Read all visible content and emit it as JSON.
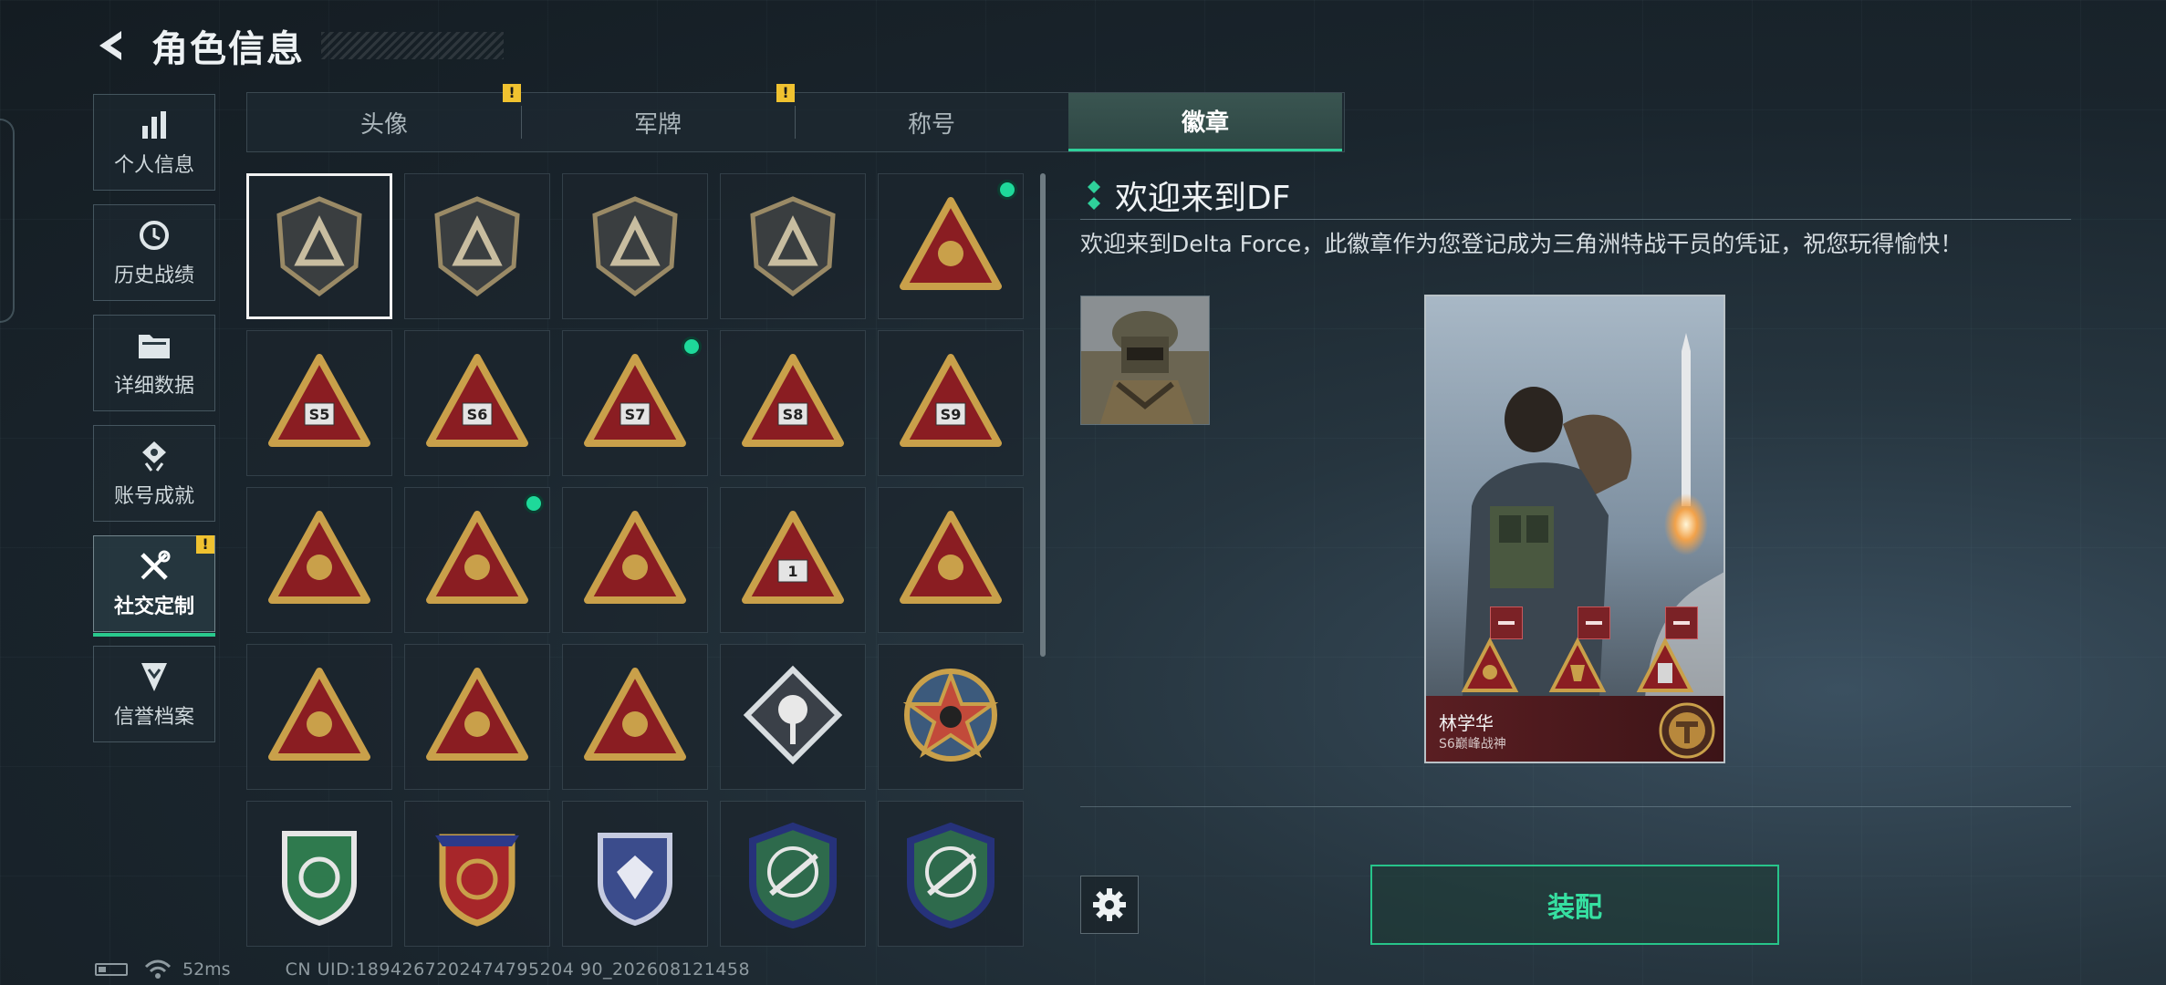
{
  "header": {
    "title": "角色信息"
  },
  "sidebar": {
    "items": [
      {
        "label": "个人信息",
        "icon": "bar-chart-icon",
        "active": false,
        "warning": false
      },
      {
        "label": "历史战绩",
        "icon": "history-clock-icon",
        "active": false,
        "warning": false
      },
      {
        "label": "详细数据",
        "icon": "folder-icon",
        "active": false,
        "warning": false
      },
      {
        "label": "账号成就",
        "icon": "medal-icon",
        "active": false,
        "warning": false
      },
      {
        "label": "社交定制",
        "icon": "tools-icon",
        "active": true,
        "warning": true
      },
      {
        "label": "信誉档案",
        "icon": "shield-check-icon",
        "active": false,
        "warning": false
      }
    ]
  },
  "tabs": [
    {
      "label": "头像",
      "active": false,
      "warning": true
    },
    {
      "label": "军牌",
      "active": false,
      "warning": true
    },
    {
      "label": "称号",
      "active": false,
      "warning": false
    },
    {
      "label": "徽章",
      "active": true,
      "warning": false
    }
  ],
  "warning_mark": "!",
  "badges": [
    {
      "type": "shield-dark",
      "glyph": "delta",
      "selected": true,
      "new": false
    },
    {
      "type": "shield-dark",
      "glyph": "helicopter",
      "selected": false,
      "new": false
    },
    {
      "type": "shield-dark",
      "glyph": "diamond",
      "selected": false,
      "new": false
    },
    {
      "type": "shield-dark",
      "glyph": "dagger",
      "selected": false,
      "new": false
    },
    {
      "type": "triangle-red",
      "glyph": "armillary",
      "selected": false,
      "new": true
    },
    {
      "type": "triangle-red",
      "glyph": "S5",
      "selected": false,
      "new": false
    },
    {
      "type": "triangle-red",
      "glyph": "S6",
      "selected": false,
      "new": false
    },
    {
      "type": "triangle-red",
      "glyph": "S7",
      "selected": false,
      "new": true
    },
    {
      "type": "triangle-red",
      "glyph": "S8",
      "selected": false,
      "new": false
    },
    {
      "type": "triangle-red",
      "glyph": "S9",
      "selected": false,
      "new": false
    },
    {
      "type": "triangle-red",
      "glyph": "figure",
      "selected": false,
      "new": false
    },
    {
      "type": "triangle-red",
      "glyph": "trophy",
      "selected": false,
      "new": true
    },
    {
      "type": "triangle-red",
      "glyph": "nest",
      "selected": false,
      "new": false
    },
    {
      "type": "triangle-red",
      "glyph": "1",
      "selected": false,
      "new": false
    },
    {
      "type": "triangle-red",
      "glyph": "kneel",
      "selected": false,
      "new": false
    },
    {
      "type": "triangle-red",
      "glyph": "hands",
      "selected": false,
      "new": false
    },
    {
      "type": "triangle-red",
      "glyph": "soldiers",
      "selected": false,
      "new": false
    },
    {
      "type": "triangle-red",
      "glyph": "fish",
      "selected": false,
      "new": false
    },
    {
      "type": "diamond-silver",
      "glyph": "rose",
      "selected": false,
      "new": false
    },
    {
      "type": "round-star",
      "glyph": "star",
      "selected": false,
      "new": false
    },
    {
      "type": "shield-green",
      "glyph": "emblem",
      "selected": false,
      "new": false
    },
    {
      "type": "shield-gold",
      "glyph": "emblem",
      "selected": false,
      "new": false
    },
    {
      "type": "shield-blue",
      "glyph": "gem",
      "selected": false,
      "new": false
    },
    {
      "type": "crest-green",
      "glyph": "rifle",
      "selected": false,
      "new": false
    },
    {
      "type": "crest-green",
      "glyph": "rifle",
      "selected": false,
      "new": false
    }
  ],
  "detail": {
    "title": "欢迎来到DF",
    "description": "欢迎来到Delta Force，此徽章作为您登记成为三角洲特战干员的凭证，祝您玩得愉快！"
  },
  "card": {
    "name": "林学华",
    "subtitle": "S6巅峰战神",
    "slots": 3
  },
  "actions": {
    "equip_label": "装配"
  },
  "status": {
    "ping": "52ms",
    "uid": "CN UID:1894267202474795204 90_202608121458"
  },
  "colors": {
    "accent": "#2fd09a",
    "warning": "#f0c230",
    "badge_red": "#8a1d22",
    "badge_gold": "#c9a04a"
  }
}
